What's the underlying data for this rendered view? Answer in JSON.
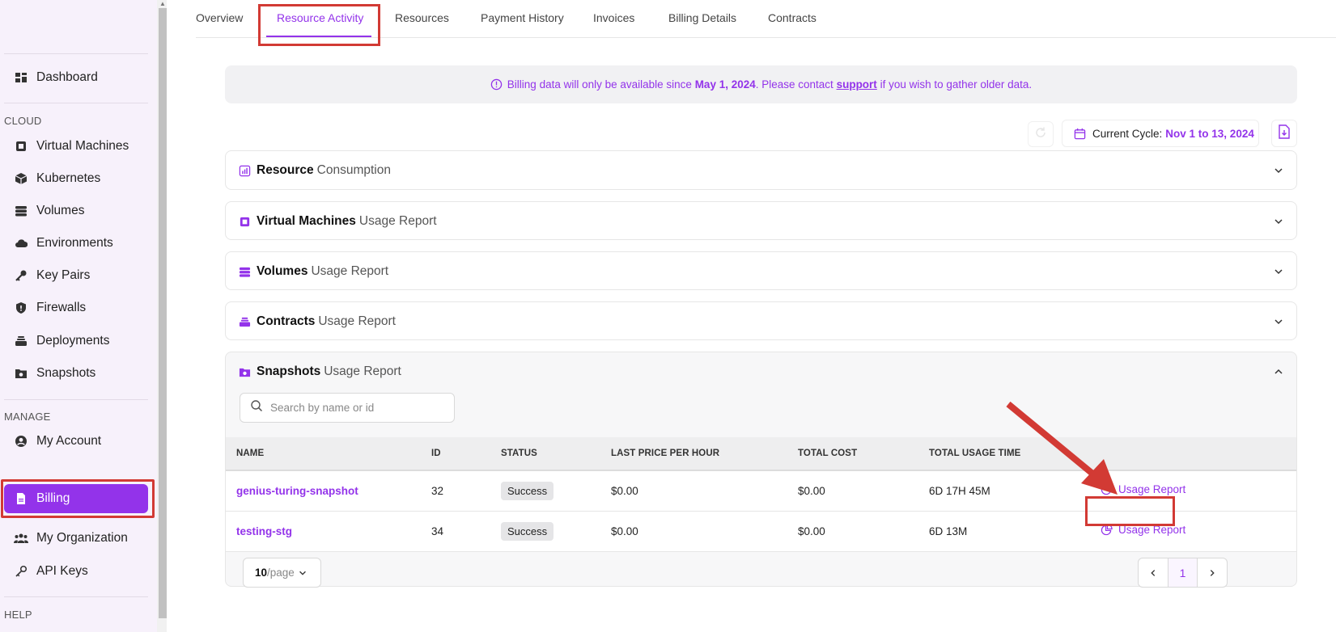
{
  "sidebar": {
    "dashboard": "Dashboard",
    "section_cloud": "CLOUD",
    "cloud_items": [
      "Virtual Machines",
      "Kubernetes",
      "Volumes",
      "Environments",
      "Key Pairs",
      "Firewalls",
      "Deployments",
      "Snapshots"
    ],
    "section_manage": "MANAGE",
    "manage_items": [
      "My Account",
      "Billing",
      "My Organization",
      "API Keys"
    ],
    "active_item": "Billing",
    "section_help": "HELP"
  },
  "tabs": [
    "Overview",
    "Resource Activity",
    "Resources",
    "Payment History",
    "Invoices",
    "Billing Details",
    "Contracts"
  ],
  "active_tab": "Resource Activity",
  "banner": {
    "prefix": "Billing data will only be available since ",
    "date": "May 1, 2024",
    "middle": ". Please contact ",
    "link": "support",
    "suffix": " if you wish to gather older data."
  },
  "cycle": {
    "label": "Current Cycle:",
    "value": "Nov 1 to 13, 2024"
  },
  "sections": [
    {
      "bold": "Resource",
      "rest": "Consumption",
      "icon": "chart-icon"
    },
    {
      "bold": "Virtual Machines",
      "rest": "Usage Report",
      "icon": "cpu-icon"
    },
    {
      "bold": "Volumes",
      "rest": "Usage Report",
      "icon": "database-icon"
    },
    {
      "bold": "Contracts",
      "rest": "Usage Report",
      "icon": "stack-icon"
    },
    {
      "bold": "Snapshots",
      "rest": "Usage Report",
      "icon": "folder-icon"
    }
  ],
  "snapshots": {
    "search_placeholder": "Search by name or id",
    "columns": [
      "NAME",
      "ID",
      "STATUS",
      "LAST PRICE PER HOUR",
      "TOTAL COST",
      "TOTAL USAGE TIME"
    ],
    "rows": [
      {
        "name": "genius-turing-snapshot",
        "id": "32",
        "status": "Success",
        "price": "$0.00",
        "cost": "$0.00",
        "time": "6D 17H 45M",
        "action": "Usage Report"
      },
      {
        "name": "testing-stg",
        "id": "34",
        "status": "Success",
        "price": "$0.00",
        "cost": "$0.00",
        "time": "6D 13M",
        "action": "Usage Report"
      }
    ],
    "page_size": "10",
    "page_size_unit": "/page",
    "current_page": "1"
  },
  "colors": {
    "accent": "#9333ea",
    "highlight": "#d23a34"
  }
}
